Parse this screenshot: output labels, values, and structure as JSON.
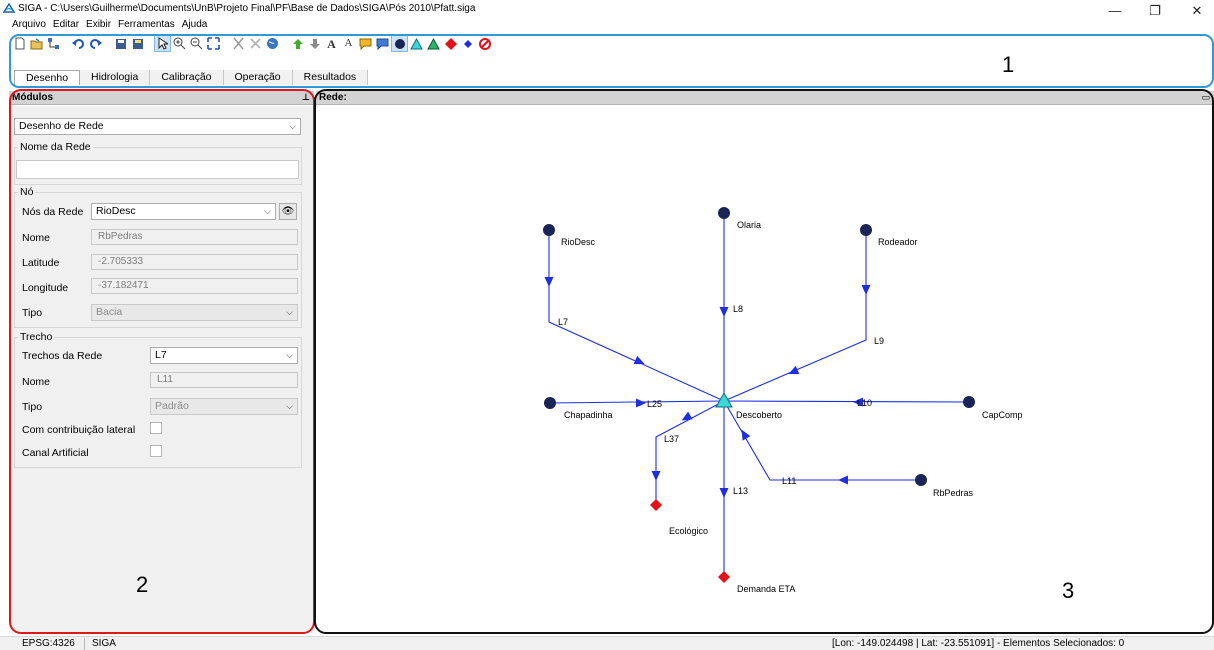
{
  "window": {
    "title": "SIGA - C:\\Users\\Guilherme\\Documents\\UnB\\Projeto Final\\PF\\Base de Dados\\SIGA\\Pós 2010\\Pfatt.siga",
    "minimize": "—",
    "restore": "❐",
    "close": "✕"
  },
  "menu": [
    "Arquivo",
    "Editar",
    "Exibir",
    "Ferramentas",
    "Ajuda"
  ],
  "tabs": [
    "Desenho",
    "Hidrologia",
    "Calibração",
    "Operação",
    "Resultados"
  ],
  "annotations": {
    "area1": "1",
    "area2": "2",
    "area3": "3"
  },
  "panel": {
    "title": "Módulos",
    "pin": "⊥",
    "module_select": "Desenho de Rede",
    "nome_rede_group": "Nome da Rede",
    "nome_rede_value": "",
    "no_group": "Nó",
    "nos_label": "Nós da Rede",
    "nos_value": "RioDesc",
    "nome_label": "Nome",
    "nome_value": "RbPedras",
    "lat_label": "Latitude",
    "lat_value": "-2.705333",
    "lon_label": "Longitude",
    "lon_value": "-37.182471",
    "tipo_label": "Tipo",
    "tipo_value": "Bacia",
    "trecho_group": "Trecho",
    "trechos_label": "Trechos da Rede",
    "trechos_value": "L7",
    "trecho_nome_label": "Nome",
    "trecho_nome_value": "L11",
    "trecho_tipo_label": "Tipo",
    "trecho_tipo_value": "Padrão",
    "contrib_label": "Com contribuição lateral",
    "canal_label": "Canal Artificial"
  },
  "map": {
    "title": "Rede:",
    "nodes": [
      {
        "name": "RioDesc",
        "kind": "bacia"
      },
      {
        "name": "Olaria",
        "kind": "bacia"
      },
      {
        "name": "Rodeador",
        "kind": "bacia"
      },
      {
        "name": "Chapadinha",
        "kind": "bacia"
      },
      {
        "name": "CapComp",
        "kind": "bacia"
      },
      {
        "name": "RbPedras",
        "kind": "bacia"
      },
      {
        "name": "Descoberto",
        "kind": "reservatorio"
      },
      {
        "name": "Ecológico",
        "kind": "demanda"
      },
      {
        "name": "Demanda ETA",
        "kind": "demanda"
      }
    ],
    "links": [
      "L7",
      "L8",
      "L9",
      "L25",
      "L10",
      "L37",
      "L11",
      "L13"
    ],
    "colors": {
      "bacia": "#1a2456",
      "reservatorio": "#3ed6d8",
      "demanda": "#e3121a",
      "link": "#1f2fe0"
    }
  },
  "status": {
    "epsg": "EPSG:4326",
    "app": "SIGA",
    "coords": "[Lon: -149.024498 | Lat: -23.551091] - Elementos Selecionados: 0"
  }
}
